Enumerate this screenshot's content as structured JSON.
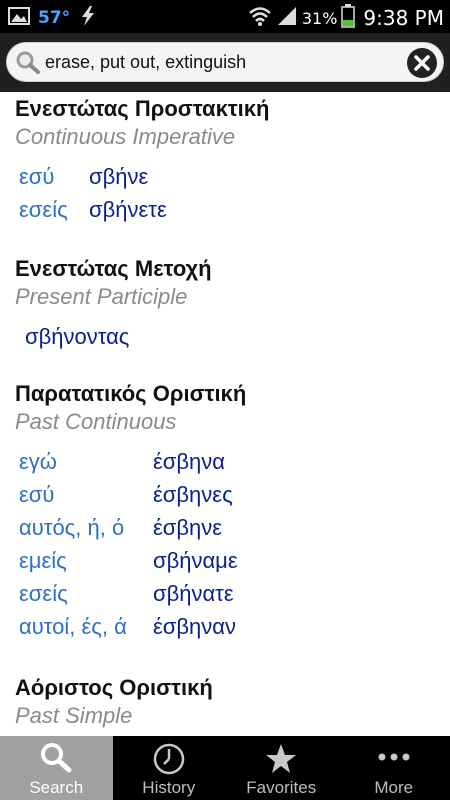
{
  "status_bar": {
    "temperature": "57°",
    "battery_percent": "31%",
    "time": "9:38 PM",
    "icons": [
      "image-icon",
      "lightning-icon",
      "wifi-icon",
      "signal-icon",
      "battery-icon"
    ]
  },
  "search": {
    "query": "erase, put out, extinguish",
    "icon": "search-icon",
    "clear_icon": "close-icon"
  },
  "sections": [
    {
      "title": "Ενεστώτας Προστακτική",
      "subtitle": "Continuous Imperative",
      "rows": [
        {
          "pronoun": "εσύ",
          "verb": "σβήνε"
        },
        {
          "pronoun": "εσείς",
          "verb": "σβήνετε"
        }
      ]
    },
    {
      "title": "Ενεστώτας Μετοχή",
      "subtitle": "Present Participle",
      "rows": [
        {
          "pronoun": "",
          "verb": "σβήνοντας"
        }
      ]
    },
    {
      "title": "Παρατατικός Οριστική",
      "subtitle": "Past Continuous",
      "rows": [
        {
          "pronoun": "εγώ",
          "verb": "έσβηνα"
        },
        {
          "pronoun": "εσύ",
          "verb": "έσβηνες"
        },
        {
          "pronoun": "αυτός, ή, ό",
          "verb": "έσβηνε"
        },
        {
          "pronoun": "εμείς",
          "verb": "σβήναμε"
        },
        {
          "pronoun": "εσείς",
          "verb": "σβήνατε"
        },
        {
          "pronoun": "αυτοί, ές, ά",
          "verb": "έσβηναν"
        }
      ]
    },
    {
      "title": "Αόριστος Οριστική",
      "subtitle": "Past Simple",
      "rows": []
    }
  ],
  "bottom_nav": {
    "items": [
      {
        "label": "Search",
        "icon": "search-icon",
        "active": true
      },
      {
        "label": "History",
        "icon": "clock-icon",
        "active": false
      },
      {
        "label": "Favorites",
        "icon": "star-icon",
        "active": false
      },
      {
        "label": "More",
        "icon": "more-dots-icon",
        "active": false
      }
    ]
  },
  "colors": {
    "pronoun": "#2f6fc8",
    "verb": "#0a1f8f",
    "subtitle": "#8a8a8a",
    "nav_active": "#a0a0a0"
  }
}
